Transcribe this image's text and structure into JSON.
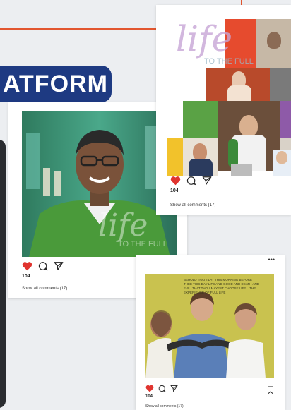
{
  "banner": {
    "text": "ATFORM"
  },
  "colors": {
    "accent": "#e2562f",
    "banner": "#1e3a82",
    "heart": "#e0342f"
  },
  "post1": {
    "logo_word": "life",
    "logo_sub": "TO THE FULL",
    "likes": "104",
    "comments_link": "Show all comments (17)",
    "icons": [
      "heart-icon",
      "comment-icon",
      "share-icon",
      "bookmark-icon"
    ]
  },
  "post2": {
    "logo_word": "life",
    "logo_sub": "TO THE FULL",
    "likes": "104",
    "comments_link": "Show all comments (17)",
    "icons": [
      "heart-icon",
      "comment-icon",
      "share-icon"
    ]
  },
  "post3": {
    "more": "•••",
    "quote": "BEHOLD THAT I LAY THIS MORNING BEFORE THEE THIS DAY LIFE AND GOOD AND DEATH AND EVIL, THAT THOU MAYEST CHOOSE LIFE... THE EXPERIENCE OF FULL LIFE",
    "likes": "104",
    "comments_link": "Show all comments (17)",
    "icons": [
      "heart-icon",
      "comment-icon",
      "share-icon",
      "bookmark-icon"
    ]
  }
}
